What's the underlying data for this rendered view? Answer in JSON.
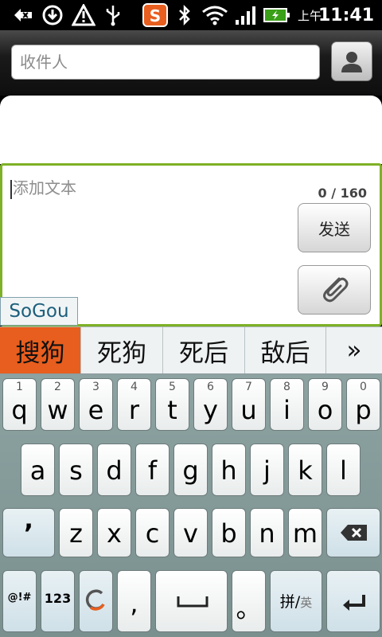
{
  "status_bar": {
    "ampm": "上午",
    "time": "11:41",
    "icons": [
      "back-arrow-icon",
      "download-icon",
      "warning-icon",
      "usb-icon",
      "sogou-app-icon",
      "bluetooth-icon",
      "wifi-icon",
      "signal-icon",
      "battery-charging-icon"
    ]
  },
  "recipient": {
    "placeholder": "收件人"
  },
  "compose": {
    "placeholder": "添加文本",
    "counter": "0 / 160",
    "send_label": "发送"
  },
  "ime": {
    "name": "SoGou"
  },
  "candidates": [
    "搜狗",
    "死狗",
    "死后",
    "敌后",
    "»"
  ],
  "keyboard": {
    "row1": [
      {
        "ch": "q",
        "num": "1"
      },
      {
        "ch": "w",
        "num": "2"
      },
      {
        "ch": "e",
        "num": "3"
      },
      {
        "ch": "r",
        "num": "4"
      },
      {
        "ch": "t",
        "num": "5"
      },
      {
        "ch": "y",
        "num": "6"
      },
      {
        "ch": "u",
        "num": "7"
      },
      {
        "ch": "i",
        "num": "8"
      },
      {
        "ch": "o",
        "num": "9"
      },
      {
        "ch": "p",
        "num": "0"
      }
    ],
    "row2": [
      "a",
      "s",
      "d",
      "f",
      "g",
      "h",
      "j",
      "k",
      "l"
    ],
    "row3_apostrophe": "’",
    "row3": [
      "z",
      "x",
      "c",
      "v",
      "b",
      "n",
      "m"
    ],
    "symbols_label": "@!#",
    "numbers_label": "123",
    "comma_label": ",",
    "period_label": "。",
    "lang_pinyin": "拼",
    "lang_sep": "/",
    "lang_english": "英"
  },
  "colors": {
    "accent_green": "#7eb126",
    "sogou_orange": "#e85e1e",
    "keyboard_bg": "#8da3a2"
  }
}
